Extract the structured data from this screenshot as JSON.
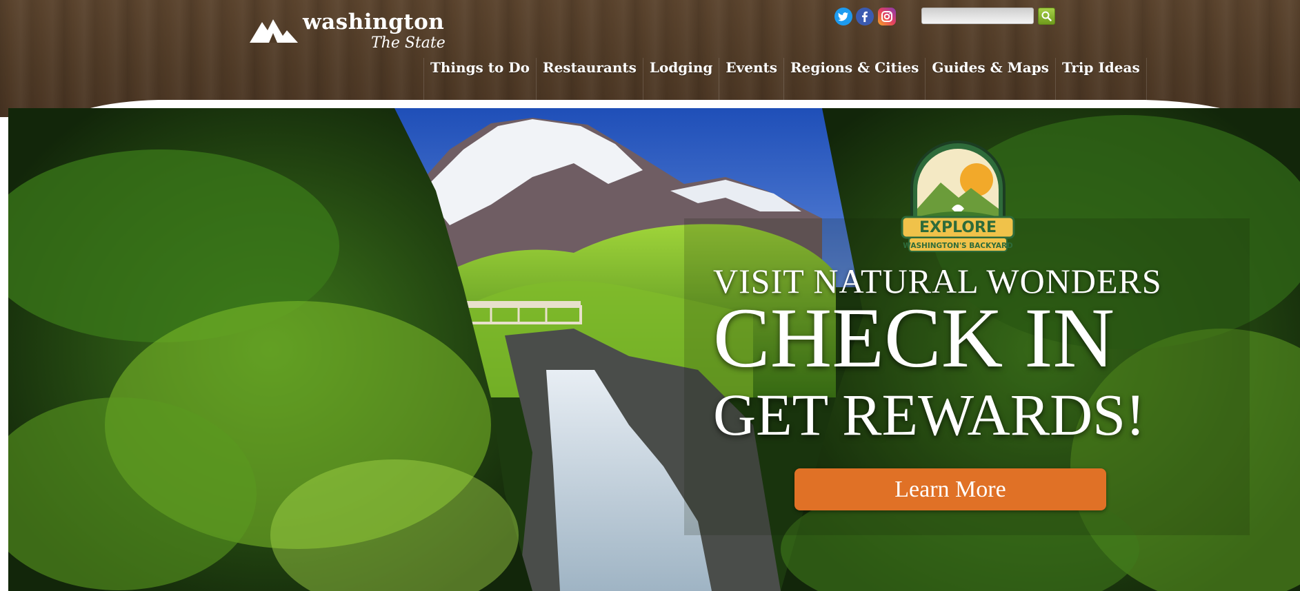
{
  "brand": {
    "name": "washington",
    "tagline": "The State"
  },
  "social": [
    {
      "name": "twitter-icon",
      "color": "#1d9bf0"
    },
    {
      "name": "facebook-icon",
      "color": "#3b5bb0"
    },
    {
      "name": "instagram-icon",
      "color": "#e4405f"
    }
  ],
  "search": {
    "placeholder": "",
    "value": "",
    "button_icon": "search-icon"
  },
  "nav": {
    "items": [
      {
        "label": "Things to Do"
      },
      {
        "label": "Restaurants"
      },
      {
        "label": "Lodging"
      },
      {
        "label": "Events"
      },
      {
        "label": "Regions & Cities"
      },
      {
        "label": "Guides & Maps"
      },
      {
        "label": "Trip Ideas"
      }
    ]
  },
  "hero": {
    "badge": {
      "title": "EXPLORE",
      "subtitle": "WASHINGTON'S BACKYARD"
    },
    "line1": "VISIT NATURAL WONDERS",
    "line2": "CHECK IN",
    "line3": "GET REWARDS!",
    "cta_label": "Learn More"
  },
  "colors": {
    "header_wood": "#4f3a26",
    "cta_orange": "#e07126",
    "search_green": "#8bbb2f"
  }
}
